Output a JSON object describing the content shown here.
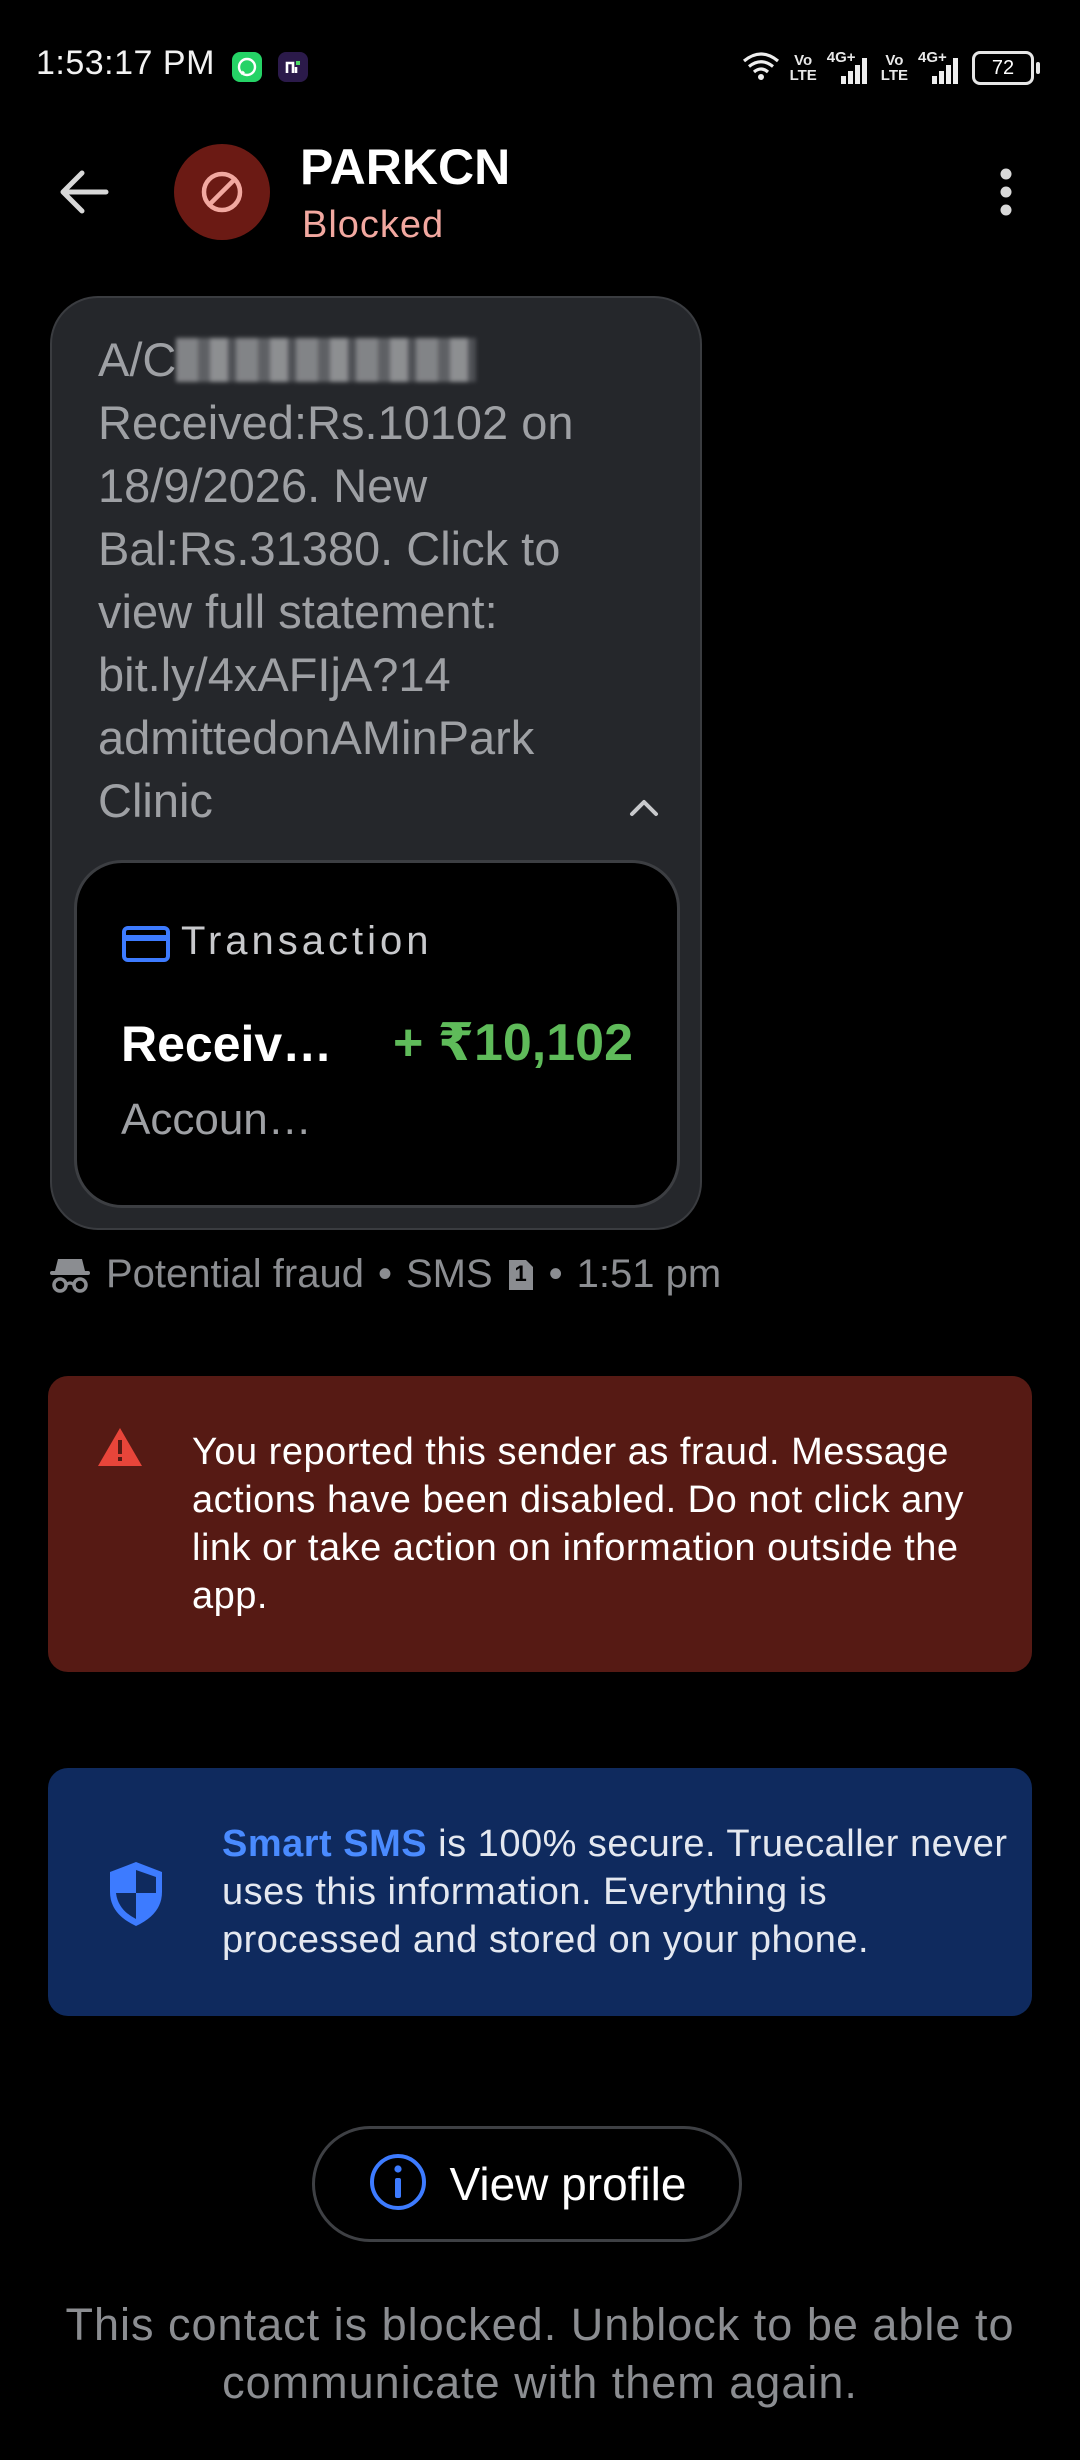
{
  "status_bar": {
    "time": "1:53:17 PM",
    "sim1_top": "Vo",
    "sim1_bottom": "LTE",
    "sim1_net": "4G+",
    "sim2_top": "Vo",
    "sim2_bottom": "LTE",
    "sim2_net": "4G+",
    "battery": "72"
  },
  "header": {
    "sender": "PARKCN",
    "status": "Blocked"
  },
  "message": {
    "prefix": "A/C",
    "body": "Received:Rs.10102 on 18/9/2026. New Bal:Rs.31380. Click to view full statement: bit.ly/4xAFIjA?14 admittedonAMinPark Clinic"
  },
  "transaction": {
    "title": "Transaction",
    "label": "Receiv…",
    "amount": "+ ₹10,102",
    "sub": "Accoun…"
  },
  "meta": {
    "category": "Potential fraud",
    "separator1": "•",
    "channel": "SMS",
    "sim": "1",
    "separator2": "•",
    "time": "1:51 pm"
  },
  "fraud_banner": {
    "text": "You reported this sender as fraud. Message actions have been disabled. Do not click any link or take action on information outside the app."
  },
  "secure_banner": {
    "brand": "Smart SMS",
    "text": " is 100% secure. Truecaller never uses this information. Everything is processed and stored on your phone."
  },
  "view_profile": {
    "label": "View profile"
  },
  "blocked_note": {
    "text": "This contact is blocked. Unblock to be able to communicate with them again."
  },
  "colors": {
    "background": "#000000",
    "bubble": "#25272b",
    "blocked_status": "#f2a8a0",
    "amount_green": "#5fbb5a",
    "fraud_bg": "#561a14",
    "secure_bg": "#0f2a5e",
    "accent_blue": "#4a8bff"
  }
}
